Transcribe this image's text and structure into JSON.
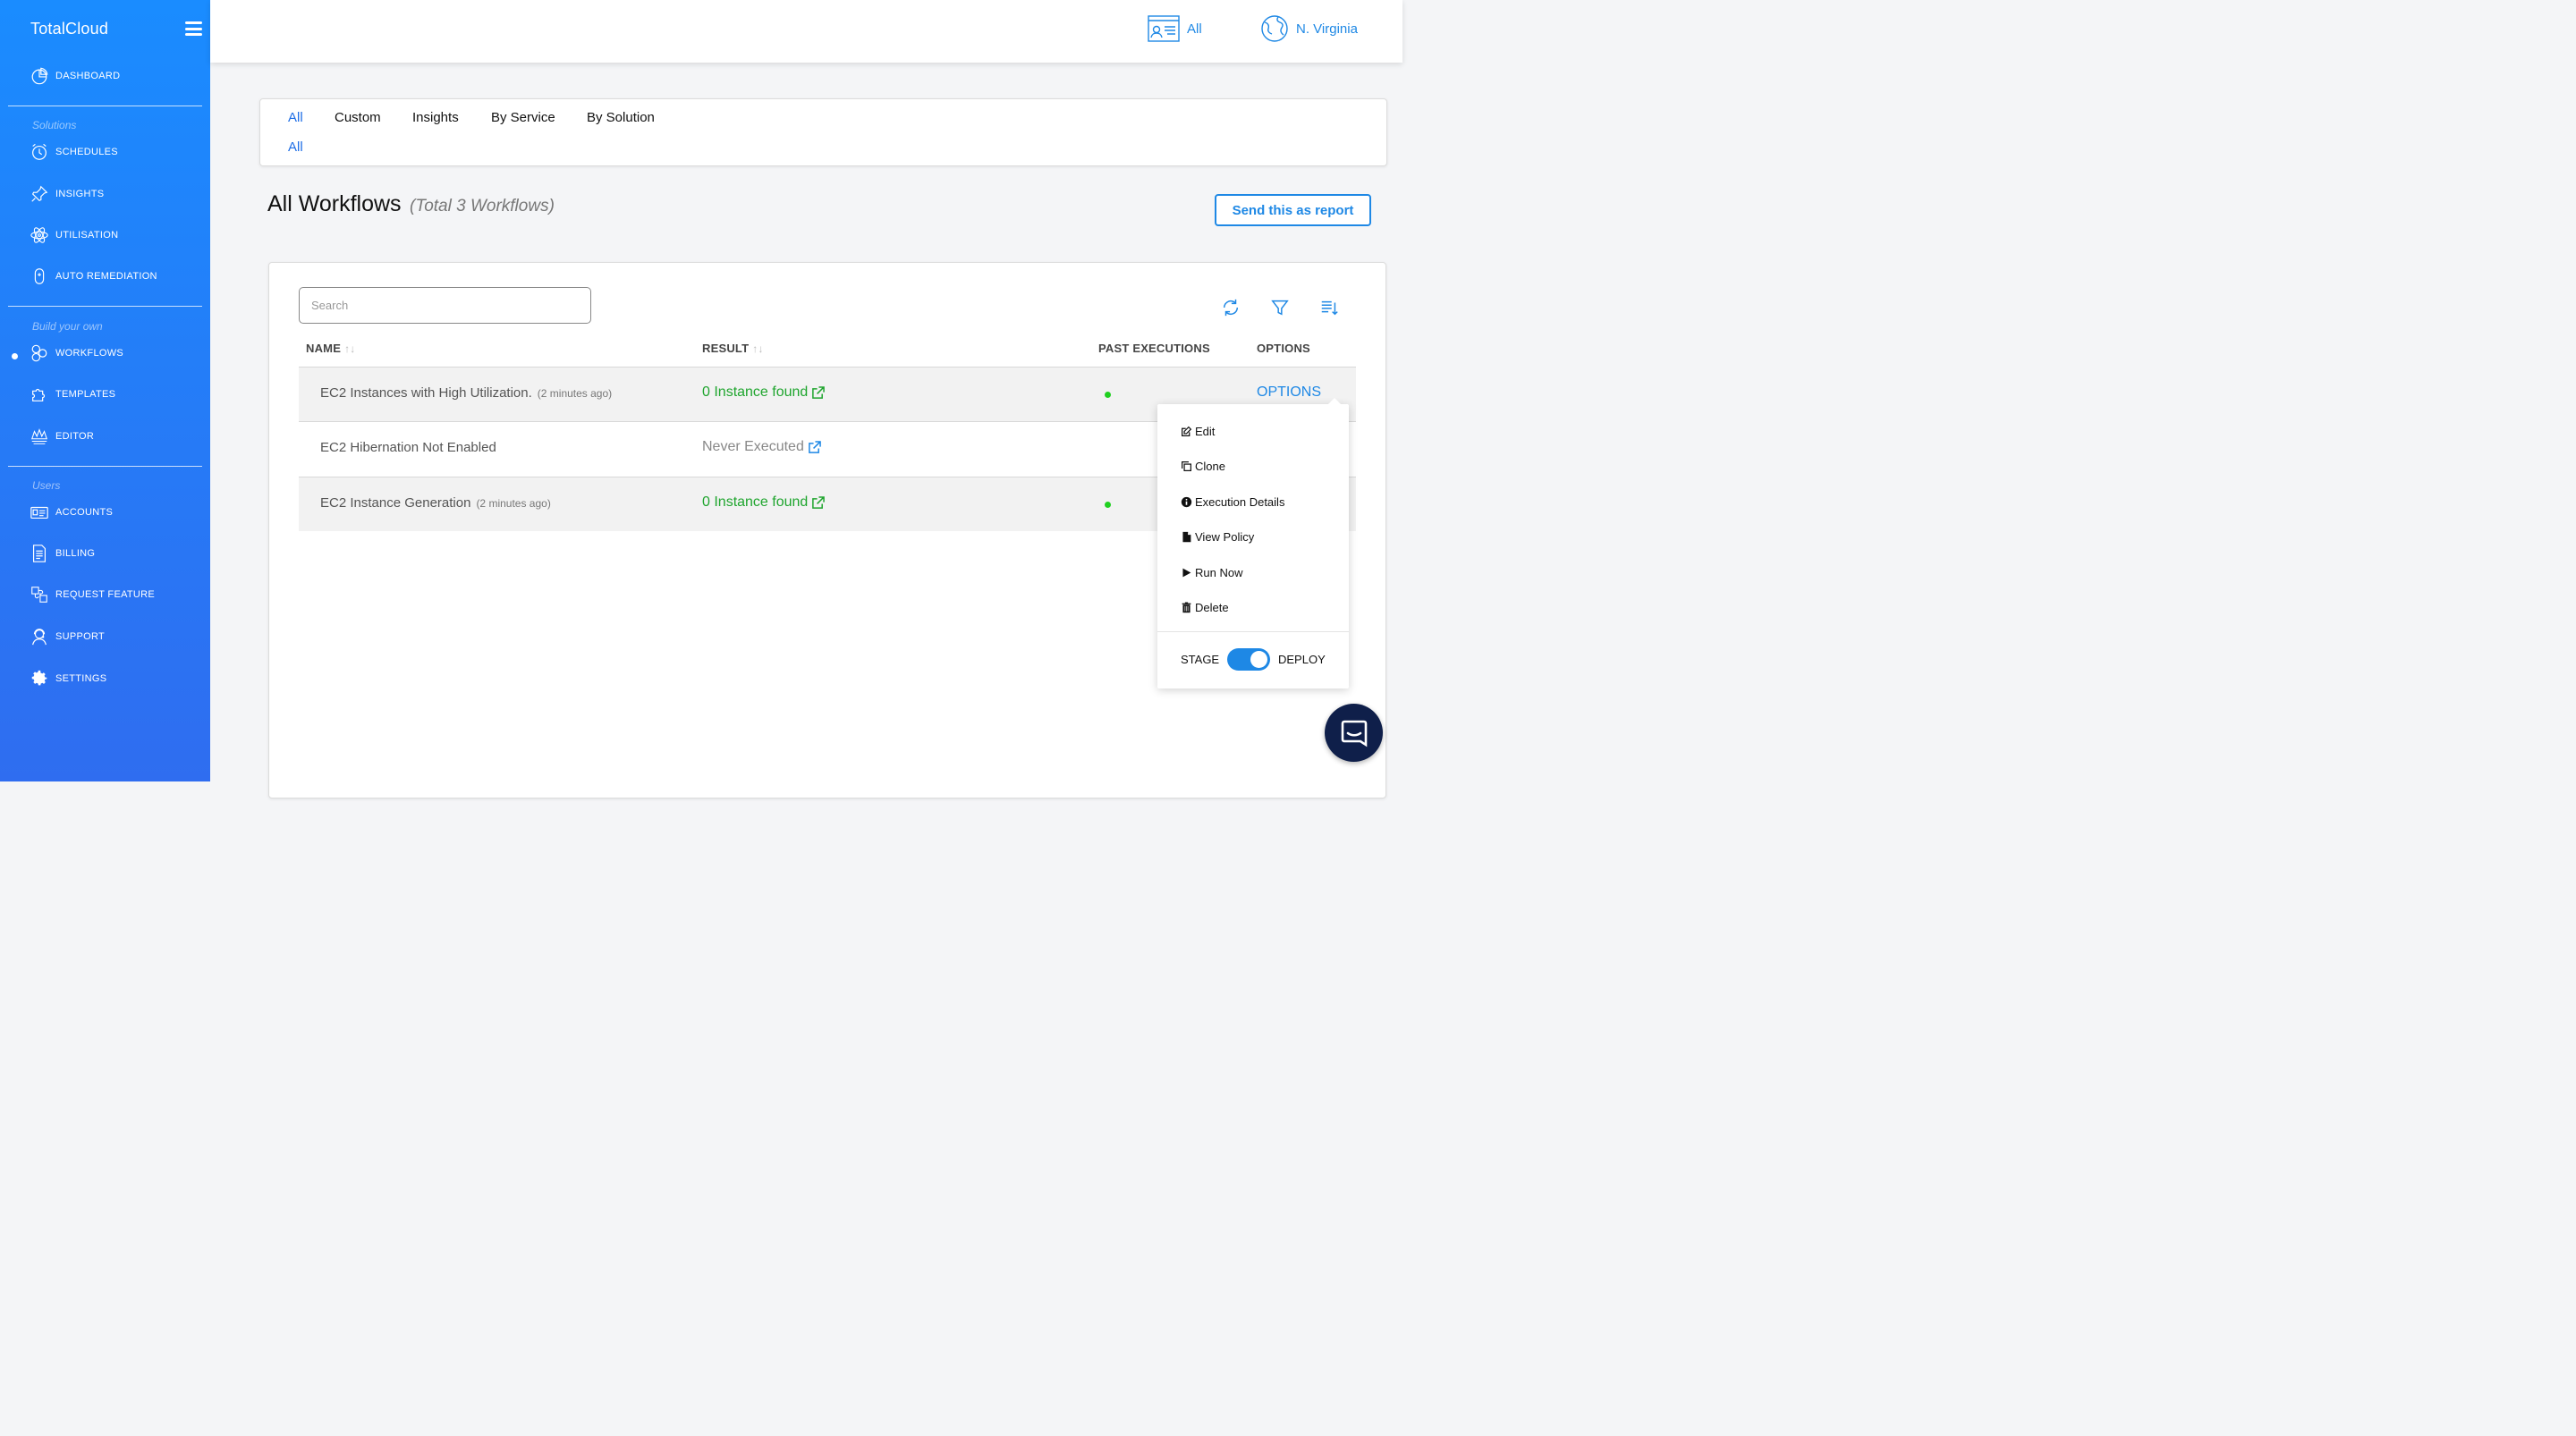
{
  "app": {
    "brand": "TotalCloud"
  },
  "sidebar": {
    "dashboard": "DASHBOARD",
    "sections": {
      "solutions": "Solutions",
      "build": "Build your own",
      "users": "Users"
    },
    "items": {
      "schedules": "SCHEDULES",
      "insights": "INSIGHTS",
      "utilisation": "UTILISATION",
      "auto_remediation": "AUTO REMEDIATION",
      "workflows": "WORKFLOWS",
      "templates": "TEMPLATES",
      "editor": "EDITOR",
      "accounts": "ACCOUNTS",
      "billing": "BILLING",
      "request_feature": "REQUEST FEATURE",
      "support": "SUPPORT",
      "settings": "SETTINGS"
    },
    "active_item": "WORKFLOWS"
  },
  "topbar": {
    "accounts_label": "All",
    "region_label": "N. Virginia"
  },
  "filters": {
    "tabs": [
      "All",
      "Custom",
      "Insights",
      "By Service",
      "By Solution"
    ],
    "active_tab": "All",
    "sub_tab": "All"
  },
  "header": {
    "title": "All Workflows",
    "subtitle": "(Total 3 Workflows)",
    "report_button": "Send this as report"
  },
  "search": {
    "placeholder": "Search",
    "value": ""
  },
  "table": {
    "columns": {
      "name": "NAME",
      "result": "RESULT",
      "past": "PAST EXECUTIONS",
      "options": "OPTIONS"
    },
    "rows": [
      {
        "name": "EC2 Instances with High Utilization.",
        "ago": "(2 minutes ago)",
        "result": "0 Instance found",
        "result_status": "found",
        "past_execution": true,
        "options": "OPTIONS"
      },
      {
        "name": "EC2 Hibernation Not Enabled",
        "ago": "",
        "result": "Never Executed",
        "result_status": "never",
        "past_execution": false,
        "options": ""
      },
      {
        "name": "EC2 Instance Generation",
        "ago": "(2 minutes ago)",
        "result": "0 Instance found",
        "result_status": "found",
        "past_execution": true,
        "options": ""
      }
    ]
  },
  "dropdown": {
    "items": {
      "edit": "Edit",
      "clone": "Clone",
      "execution_details": "Execution Details",
      "view_policy": "View Policy",
      "run_now": "Run Now",
      "delete": "Delete"
    },
    "stage_label": "STAGE",
    "deploy_label": "DEPLOY",
    "toggle_on": true
  },
  "colors": {
    "sidebar_top": "#1a8cff",
    "sidebar_bottom": "#2f6df0",
    "accent": "#1e88e5",
    "success": "#1fa52e",
    "muted": "#888888",
    "dot": "#20d020",
    "chat": "#0f1f4a"
  }
}
